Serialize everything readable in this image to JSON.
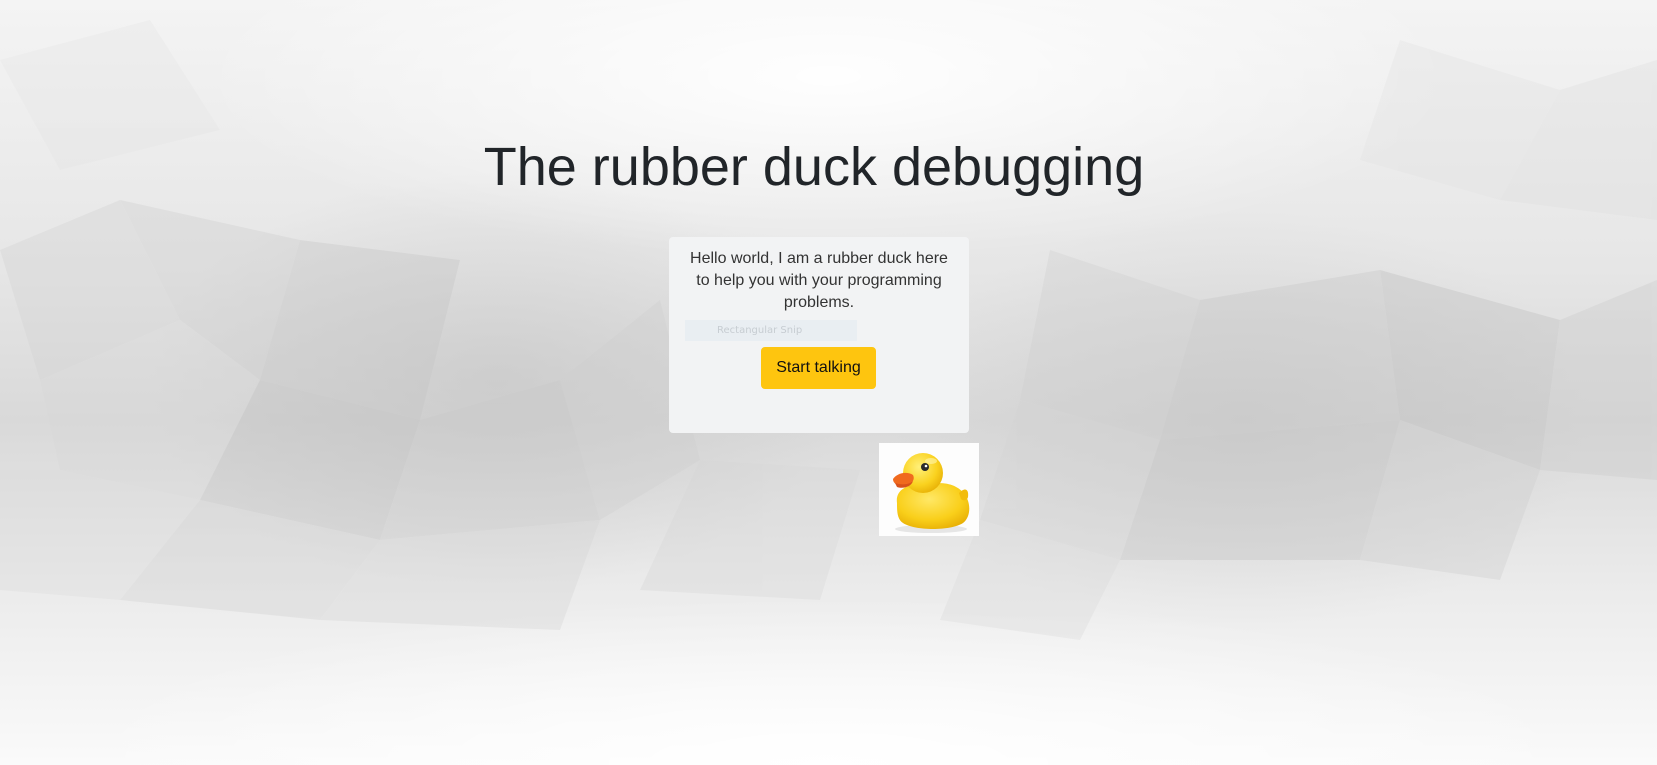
{
  "header": {
    "title": "The rubber duck debugging"
  },
  "intro_card": {
    "message": "Hello world, I am a rubber duck here to help you with your programming problems.",
    "snip_overlay_label": "Rectangular Snip",
    "start_button_label": "Start talking"
  },
  "duck": {
    "icon": "rubber-duck-icon"
  },
  "colors": {
    "accent_button": "#fec50f",
    "card_background": "#f2f3f4",
    "title_text": "#212529"
  }
}
